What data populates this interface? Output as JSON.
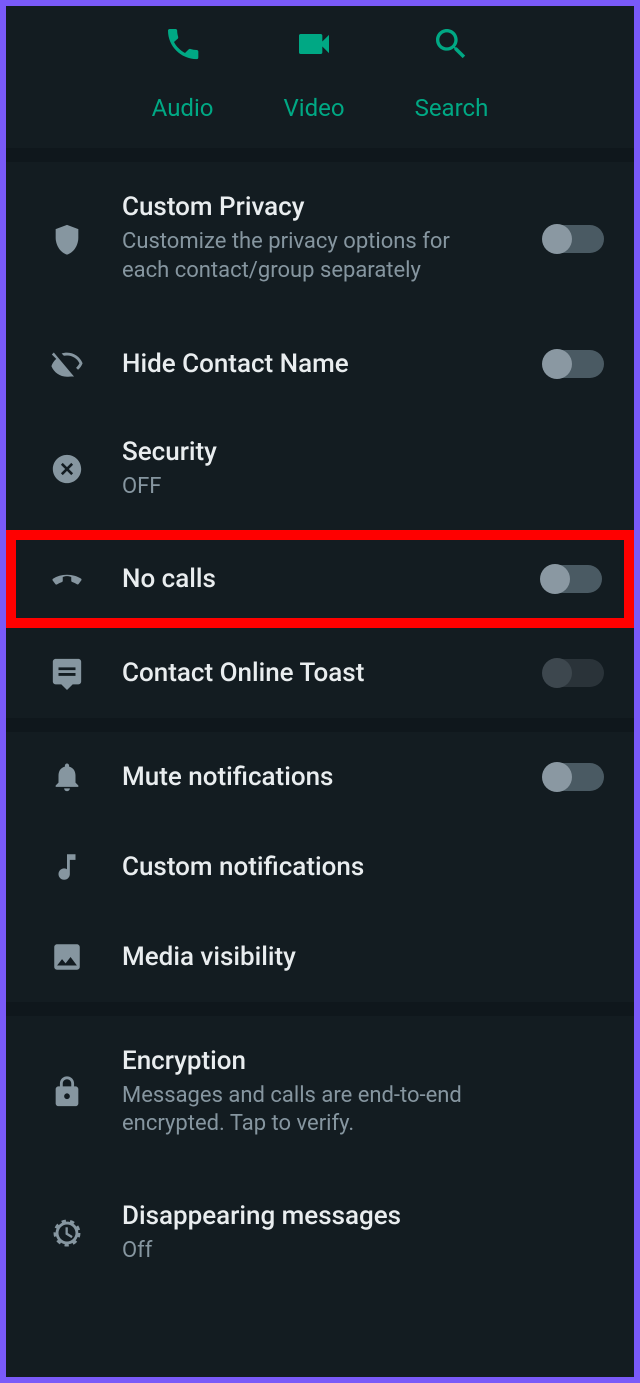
{
  "actions": {
    "audio": "Audio",
    "video": "Video",
    "search": "Search"
  },
  "rows": {
    "custom_privacy": {
      "title": "Custom Privacy",
      "sub": "Customize the privacy options for each contact/group separately"
    },
    "hide_contact_name": {
      "title": "Hide Contact Name"
    },
    "security": {
      "title": "Security",
      "sub": "OFF"
    },
    "no_calls": {
      "title": "No calls"
    },
    "contact_online_toast": {
      "title": "Contact Online Toast"
    },
    "mute_notifications": {
      "title": "Mute notifications"
    },
    "custom_notifications": {
      "title": "Custom notifications"
    },
    "media_visibility": {
      "title": "Media visibility"
    },
    "encryption": {
      "title": "Encryption",
      "sub": "Messages and calls are end-to-end encrypted. Tap to verify."
    },
    "disappearing_messages": {
      "title": "Disappearing messages",
      "sub": "Off"
    }
  }
}
